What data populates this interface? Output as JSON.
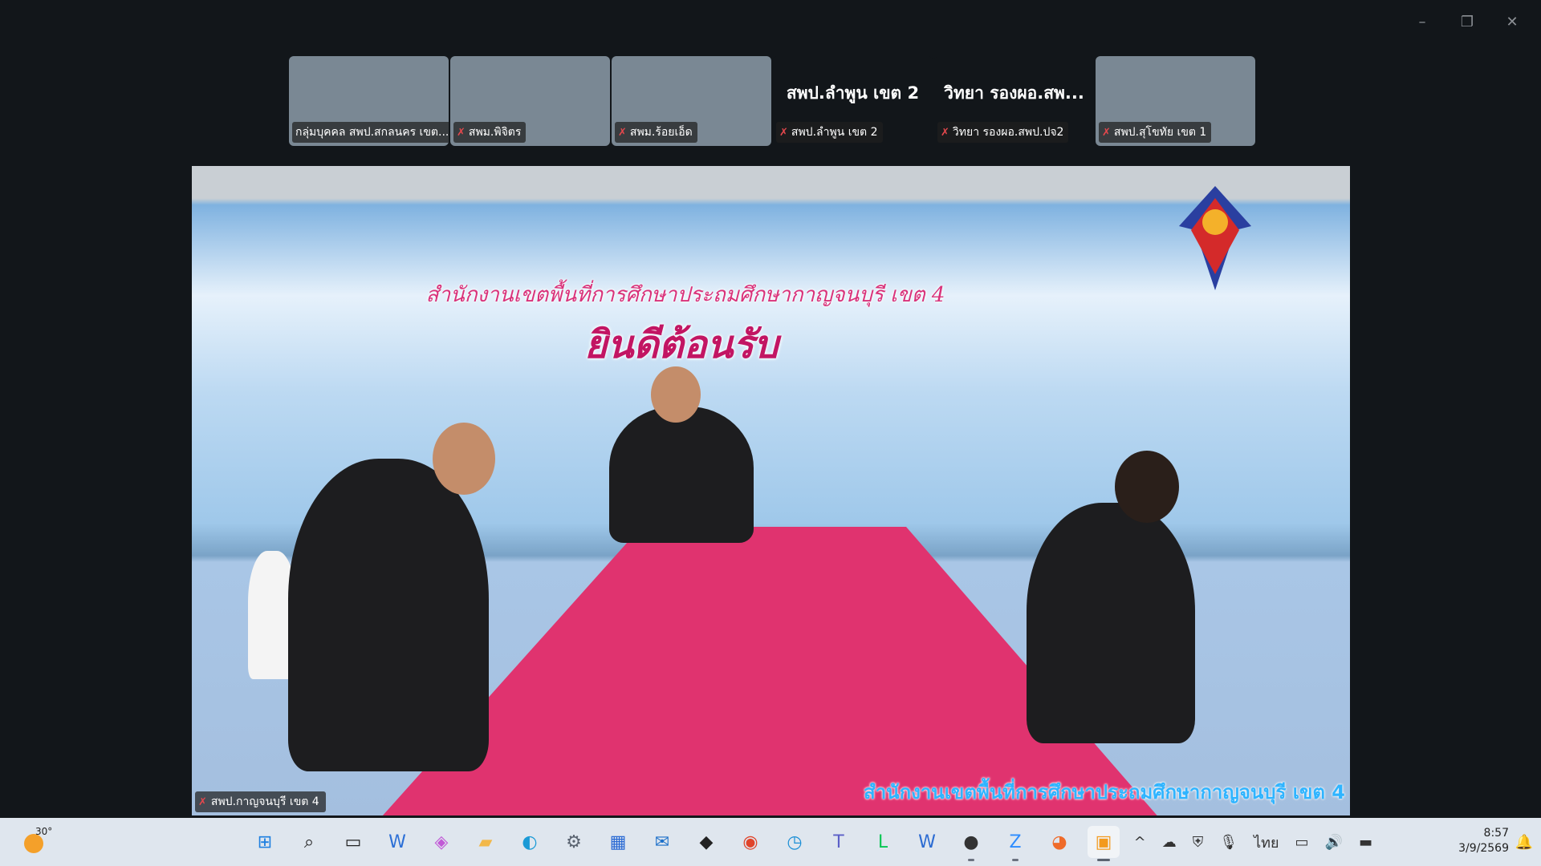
{
  "window": {
    "controls": [
      "–",
      "❐",
      "✕"
    ]
  },
  "participants": [
    {
      "name": "กลุ่มบุคคล สพป.สกลนคร เขต...",
      "video": true,
      "muted": false,
      "scene": "sc1"
    },
    {
      "name": "สพม.พิจิตร",
      "video": true,
      "muted": true,
      "scene": "sc2"
    },
    {
      "name": "สพม.ร้อยเอ็ด",
      "video": true,
      "muted": true,
      "scene": "sc3"
    },
    {
      "name": "สพป.ลำพูน เขต 2",
      "video": false,
      "muted": true,
      "display": "สพป.ลำพูน เขต 2"
    },
    {
      "name": "วิทยา รองผอ.สพป.ปจ2",
      "video": false,
      "muted": true,
      "display": "วิทยา รองผอ.สพ..."
    },
    {
      "name": "สพป.สุโขทัย เขต 1",
      "video": true,
      "muted": true,
      "scene": "sc6"
    }
  ],
  "main_video": {
    "banner_line1": "สำนักงานเขตพื้นที่การศึกษาประถมศึกษากาญจนบุรี เขต 4",
    "banner_line2": "ยินดีต้อนรับ",
    "caption": "สำนักงานเขตพื้นที่การศึกษาประถมศึกษากาญจนบุรี เขต 4",
    "speaker_name": "สพป.กาญจนบุรี เขต 4"
  },
  "taskbar": {
    "weather_temp": "30°",
    "apps": [
      {
        "name": "start",
        "glyph": "⊞",
        "color": "#1d7fe0"
      },
      {
        "name": "search",
        "glyph": "⌕",
        "color": "#222"
      },
      {
        "name": "task-view",
        "glyph": "▭",
        "color": "#222"
      },
      {
        "name": "webex",
        "glyph": "W",
        "color": "#2c6fd6"
      },
      {
        "name": "copilot",
        "glyph": "◈",
        "color": "#c159d6"
      },
      {
        "name": "file-explorer",
        "glyph": "▰",
        "color": "#f2b84a"
      },
      {
        "name": "edge",
        "glyph": "◐",
        "color": "#1a9ad6"
      },
      {
        "name": "settings",
        "glyph": "⚙",
        "color": "#5a6370"
      },
      {
        "name": "store",
        "glyph": "▦",
        "color": "#2a6ad4"
      },
      {
        "name": "outlook",
        "glyph": "✉",
        "color": "#1b6fc9"
      },
      {
        "name": "dropbox",
        "glyph": "◆",
        "color": "#222"
      },
      {
        "name": "chrome",
        "glyph": "◉",
        "color": "#e0442a"
      },
      {
        "name": "clock-app",
        "glyph": "◷",
        "color": "#1c8fd6"
      },
      {
        "name": "teams",
        "glyph": "T",
        "color": "#5b5fc7"
      },
      {
        "name": "line",
        "glyph": "L",
        "color": "#06c755"
      },
      {
        "name": "word",
        "glyph": "W",
        "color": "#2b6bd2"
      },
      {
        "name": "app-dark",
        "glyph": "●",
        "color": "#333"
      },
      {
        "name": "zoom",
        "glyph": "Z",
        "color": "#2d8cff"
      },
      {
        "name": "firefox",
        "glyph": "◕",
        "color": "#ef6b2a"
      },
      {
        "name": "app-orange",
        "glyph": "▣",
        "color": "#f39a1e"
      }
    ],
    "tray": {
      "chevron": "^",
      "lang": "ไทย"
    },
    "time": "8:57",
    "date": "3/9/2569"
  }
}
